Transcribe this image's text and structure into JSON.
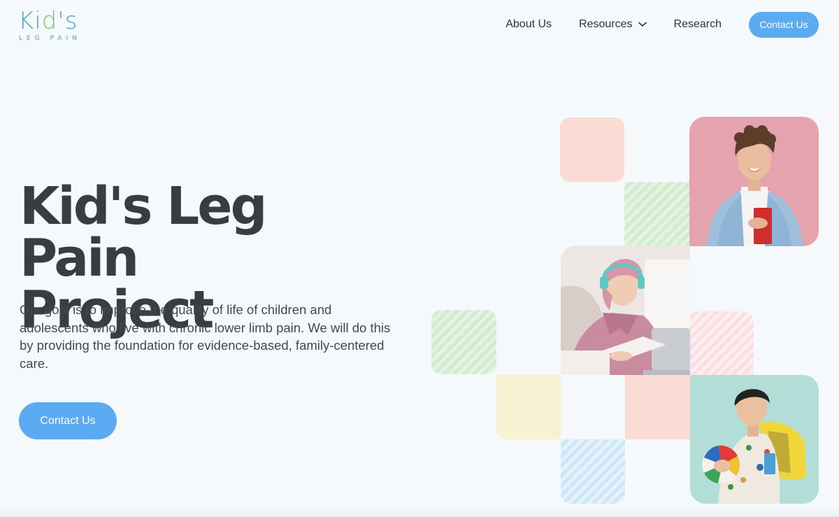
{
  "logo": {
    "word_a": "Ki",
    "word_b": "d",
    "word_c": "'s",
    "sub": "LEG PAIN"
  },
  "nav": {
    "items": [
      "About Us",
      "Resources",
      "Research"
    ],
    "contact_label": "Contact Us"
  },
  "icons": {
    "resources_dropdown": "chevron-down-icon"
  },
  "hero": {
    "title_line1": "Kid's Leg Pain",
    "title_line2": "Project",
    "description": "Our goal is to improve the quality of life of children and adolescents who live with chronic lower limb pain. We will do this by providing the foundation for evidence-based, family-centered care.",
    "cta_label": "Contact Us"
  },
  "colors": {
    "accent": "#5aabf1",
    "background": "#f5f9fc",
    "heading": "#3a3d3f",
    "tile_peach": "#fadcd4",
    "tile_pink_photo": "#e5a3ad",
    "tile_cream": "#f8f2d2",
    "tile_mint_photo": "#b3ddd7"
  },
  "photos": [
    {
      "name": "teen-boy-with-book-photo"
    },
    {
      "name": "girl-with-headphones-studying-photo"
    },
    {
      "name": "boy-with-ball-and-backpack-photo"
    }
  ]
}
